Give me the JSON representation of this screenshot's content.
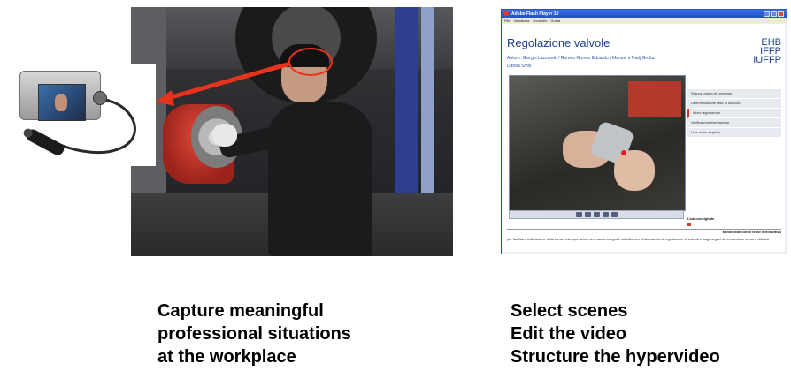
{
  "left_panel": {
    "caption_lines": [
      "Capture meaningful",
      "professional situations",
      "at the workplace"
    ]
  },
  "right_panel": {
    "window_title": "Adobe Flash Player 10",
    "menu_items": [
      "File",
      "Visualizza",
      "Controllo",
      "Guida"
    ],
    "heading": "Regolazione valvole",
    "authors": "Autore: Giorgio Lazzaretti / Romeo Gomez Edoardo / Manuel e Nadj Grotta",
    "author2": "Danda Smis",
    "logo_lines": [
      "EHB",
      "IFFP",
      "IUFFP"
    ],
    "side_menu": [
      "Stacca organi di comando",
      "Determinazione fase di bilancio",
      "Inizio regolazione",
      "Verifica movimentazione",
      "Una mano esperta..."
    ],
    "active_menu_index": 2,
    "links_label": "Link consigliate",
    "intro_label": "Mostra/Nascondi testo introduttivo",
    "intro_text": "per facilitare l'attivazione della lama nelle operazioni che vanno eseguite sui bilanceri della valvola di regolazione di valvola è sugli organi di comando in corso e distanti",
    "caption_lines": [
      "Select scenes",
      "Edit the video",
      "Structure the hypervideo"
    ]
  },
  "colors": {
    "arrow": "#e8331c",
    "title_blue": "#1b3f8f"
  }
}
